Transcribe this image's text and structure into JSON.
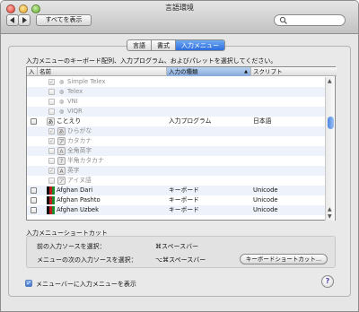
{
  "window": {
    "title": "言語環境"
  },
  "toolbar": {
    "show_all": "すべてを表示",
    "search_placeholder": ""
  },
  "tabs": [
    {
      "label": "言語",
      "active": false
    },
    {
      "label": "書式",
      "active": false
    },
    {
      "label": "入力メニュー",
      "active": true
    }
  ],
  "instructions": "入力メニューのキーボード配列、入力プログラム、およびパレットを選択してください。",
  "table": {
    "headers": {
      "enabled": "入",
      "name": "名前",
      "kind": "入力の種類",
      "script": "スクリプト"
    },
    "rows": [
      {
        "checked": true,
        "dim": true,
        "indent": true,
        "icon": "globe-icon",
        "name": "Simple Telex",
        "kind": "",
        "script": ""
      },
      {
        "checked": false,
        "dim": true,
        "indent": true,
        "icon": "globe-icon",
        "name": "Telex",
        "kind": "",
        "script": ""
      },
      {
        "checked": false,
        "dim": true,
        "indent": true,
        "icon": "globe-icon",
        "name": "VNI",
        "kind": "",
        "script": ""
      },
      {
        "checked": false,
        "dim": true,
        "indent": true,
        "icon": "globe-icon",
        "name": "VIQR",
        "kind": "",
        "script": ""
      },
      {
        "checked": false,
        "dim": false,
        "indent": false,
        "icon": "kotoeri-icon",
        "name": "ことえり",
        "kind": "入力プログラム",
        "script": "日本語"
      },
      {
        "checked": true,
        "dim": true,
        "indent": true,
        "icon": "hiragana-icon",
        "name": "ひらがな",
        "kind": "",
        "script": ""
      },
      {
        "checked": true,
        "dim": true,
        "indent": true,
        "icon": "katakana-icon",
        "name": "カタカナ",
        "kind": "",
        "script": ""
      },
      {
        "checked": false,
        "dim": true,
        "indent": true,
        "icon": "fullwidth-alpha-icon",
        "name": "全角英字",
        "kind": "",
        "script": ""
      },
      {
        "checked": false,
        "dim": true,
        "indent": true,
        "icon": "halfwidth-kana-icon",
        "name": "半角カタカナ",
        "kind": "",
        "script": ""
      },
      {
        "checked": true,
        "dim": true,
        "indent": true,
        "icon": "alpha-icon",
        "name": "英字",
        "kind": "",
        "script": ""
      },
      {
        "checked": false,
        "dim": true,
        "indent": true,
        "icon": "ainu-icon",
        "name": "アイヌ語",
        "kind": "",
        "script": ""
      },
      {
        "checked": false,
        "dim": false,
        "indent": false,
        "icon": "afghan-flag-icon",
        "name": "Afghan Dari",
        "kind": "キーボード",
        "script": "Unicode"
      },
      {
        "checked": false,
        "dim": false,
        "indent": false,
        "icon": "afghan-flag-icon",
        "name": "Afghan Pashto",
        "kind": "キーボード",
        "script": "Unicode"
      },
      {
        "checked": false,
        "dim": false,
        "indent": false,
        "icon": "afghan-flag-icon",
        "name": "Afghan Uzbek",
        "kind": "キーボード",
        "script": "Unicode"
      }
    ]
  },
  "shortcuts": {
    "section_title": "入力メニューショートカット",
    "prev_label": "前の入力ソースを選択：",
    "prev_value": "⌘スペースバー",
    "next_label": "メニューの次の入力ソースを選択：",
    "next_value": "⌥⌘スペースバー",
    "keyboard_button": "キーボードショートカット..."
  },
  "show_in_menubar": {
    "label": "メニューバーに入力メニューを表示",
    "checked": true
  },
  "help": "?",
  "colors": {
    "accent": "#3875d7",
    "row_alt": "#eef3fb"
  }
}
